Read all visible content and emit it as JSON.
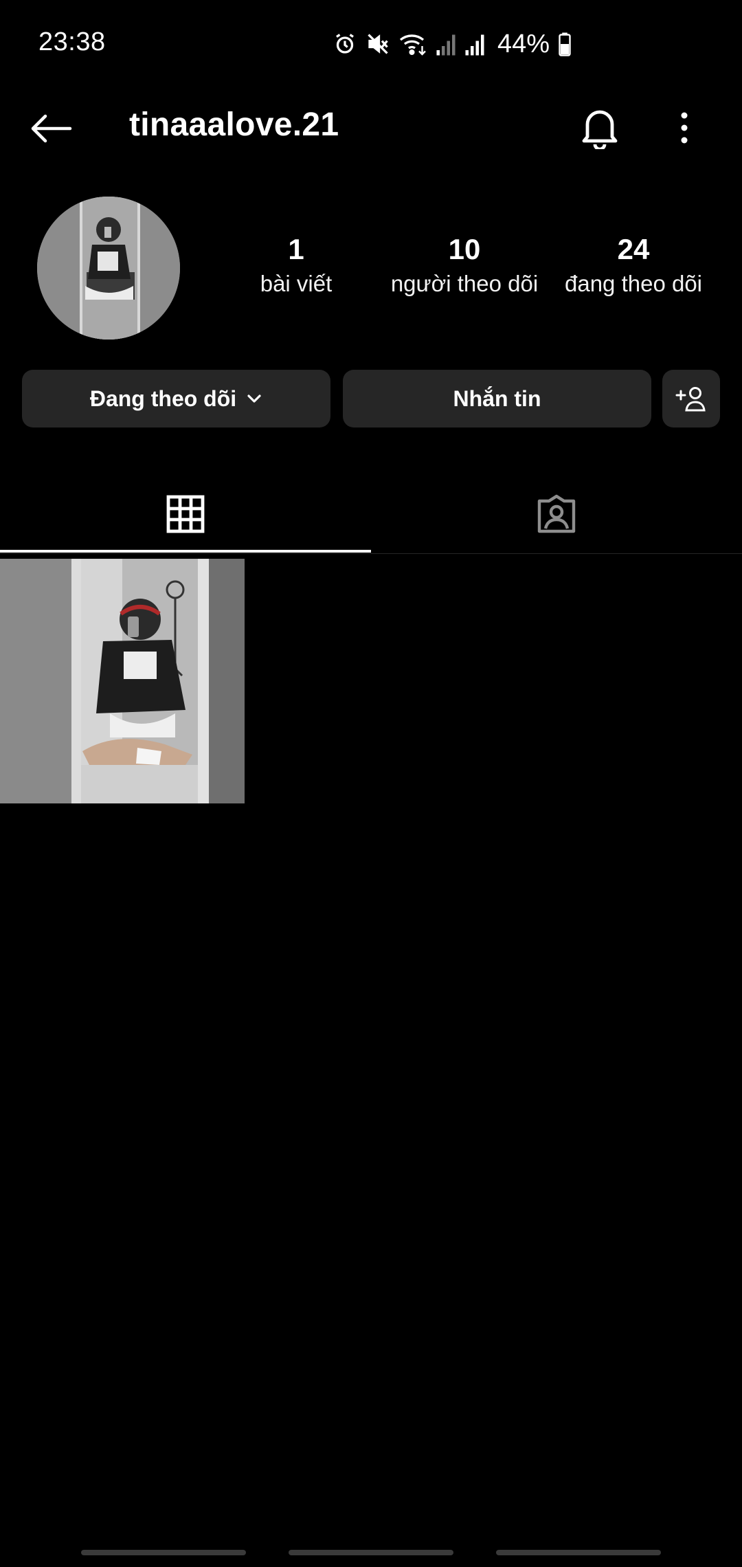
{
  "status_bar": {
    "time": "23:38",
    "battery_percent": "44%",
    "icons": [
      "alarm-icon",
      "mute-icon",
      "wifi-icon",
      "signal-icon",
      "signal-icon",
      "battery-icon"
    ]
  },
  "header": {
    "username": "tinaaalove.21",
    "icons": [
      "back-arrow-icon",
      "bell-icon",
      "more-vertical-icon"
    ]
  },
  "profile": {
    "stats": [
      {
        "value": "1",
        "label": "bài viết"
      },
      {
        "value": "10",
        "label": "người theo dõi"
      },
      {
        "value": "24",
        "label": "đang theo dõi"
      }
    ]
  },
  "actions": {
    "following_label": "Đang theo dõi",
    "message_label": "Nhắn tin",
    "icons": [
      "chevron-down-icon",
      "add-person-icon"
    ]
  },
  "tabs": {
    "items": [
      "grid-icon",
      "tagged-icon"
    ],
    "active_index": 0
  },
  "posts": {
    "count": 1
  },
  "colors": {
    "background": "#000000",
    "button_background": "#262626",
    "text": "#ffffff"
  }
}
